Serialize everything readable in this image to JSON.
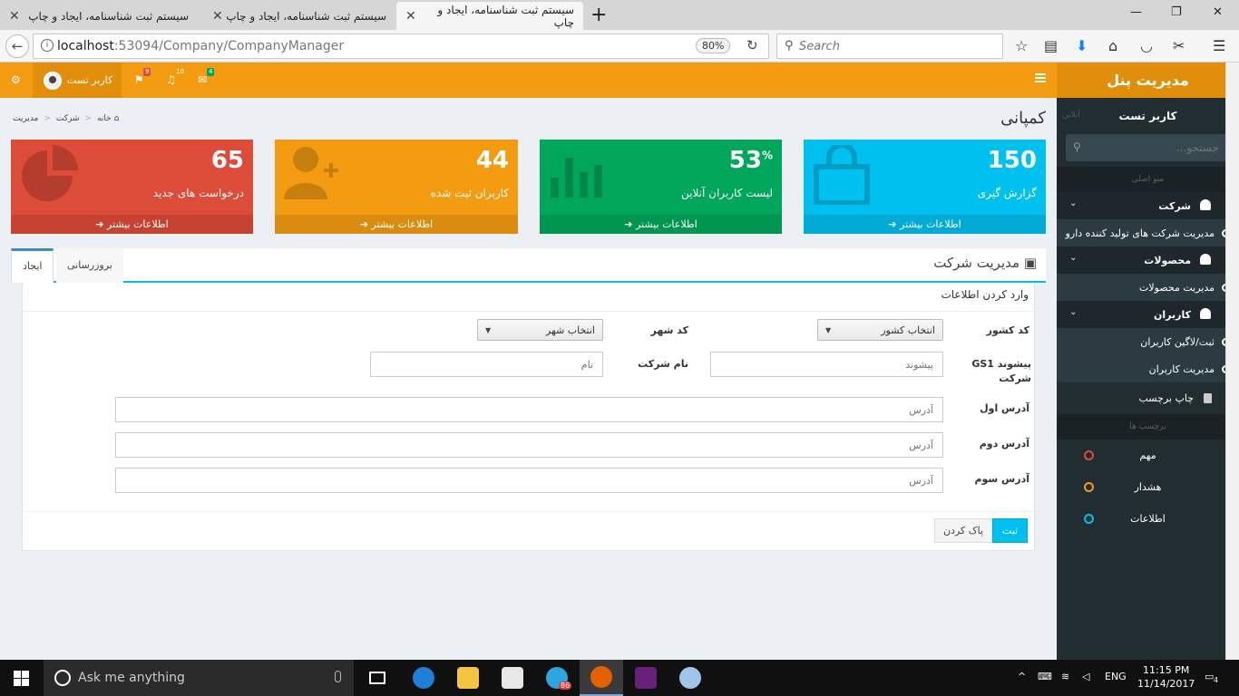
{
  "browser": {
    "tabs": [
      {
        "title": "سیستم ثبت شناسنامه، ایجاد و چاپ",
        "active": false
      },
      {
        "title": "سیستم ثبت شناسنامه، ایجاد و چاپ",
        "active": false
      },
      {
        "title": "سیستم ثبت شناسنامه، ایجاد و چاپ",
        "active": true
      }
    ],
    "url_host": "localhost",
    "url_rest": ":53094/Company/CompanyManager",
    "zoom": "80%",
    "search_placeholder": "Search"
  },
  "sidebar": {
    "brand": "مدیریت پنل",
    "user": "کاربر تست",
    "status": "آنلاین",
    "search_placeholder": "جستجو...",
    "main_header": "منو اصلی",
    "groups": [
      {
        "label": "شرکت",
        "sub": [
          "مدیریت شرکت های تولید کننده دارو"
        ]
      },
      {
        "label": "محصولات",
        "sub": [
          "مدیریت محصولات"
        ]
      },
      {
        "label": "کاربران",
        "sub": [
          "ثبت/لاگین کاربران",
          "مدیریت کاربران"
        ]
      }
    ],
    "print_label": "چاپ برچسب",
    "labels_header": "برچسب ها",
    "labels": [
      {
        "text": "مهم",
        "color": "#dd4b39"
      },
      {
        "text": "هشدار",
        "color": "#f39c12"
      },
      {
        "text": "اطلاعات",
        "color": "#00c0ef"
      }
    ]
  },
  "header": {
    "user": "کاربر تست",
    "flag_badge": "9",
    "bell_badge": "10",
    "mail_badge": "4"
  },
  "page": {
    "title": "کمپانی",
    "breadcrumb": [
      "خانه",
      "شرکت",
      "مدیریت"
    ]
  },
  "stats": [
    {
      "value": "150",
      "suffix": "",
      "label": "گزارش گیری",
      "more": "اطلاعات بیشتر",
      "color": "#00c0ef",
      "icon": "shopping-bag-icon"
    },
    {
      "value": "53",
      "suffix": "%",
      "label": "لیست کاربران آنلاین",
      "more": "اطلاعات بیشتر",
      "color": "#00a65a",
      "icon": "bar-chart-icon"
    },
    {
      "value": "44",
      "suffix": "",
      "label": "کاربران ثبت شده",
      "more": "اطلاعات بیشتر",
      "color": "#f39c12",
      "icon": "user-add-icon"
    },
    {
      "value": "65",
      "suffix": "",
      "label": "درخواست های جدید",
      "more": "اطلاعات بیشتر",
      "color": "#dd4b39",
      "icon": "pie-chart-icon"
    }
  ],
  "panel": {
    "title": "مدیریت شرکت",
    "tab_create": "ایجاد",
    "tab_update": "بروزرسانی",
    "form_title": "وارد کردن اطلاعات"
  },
  "form": {
    "country_label": "کد کشور",
    "country_select": "انتخاب کشور",
    "city_label": "کد شهر",
    "city_select": "انتخاب شهر",
    "prefix_label": "پیشوند GS1 شرکت",
    "prefix_placeholder": "پیشوند",
    "name_label": "نام شرکت",
    "name_placeholder": "نام",
    "addr1_label": "آدرس اول",
    "addr2_label": "آدرس دوم",
    "addr3_label": "آدرس سوم",
    "addr_placeholder": "آدرس",
    "submit": "ثبت",
    "clear": "پاک کردن"
  },
  "taskbar": {
    "search": "Ask me anything",
    "telegram_badge": "86",
    "lang": "ENG",
    "time": "11:15 PM",
    "date": "11/14/2017",
    "notif": "4"
  }
}
